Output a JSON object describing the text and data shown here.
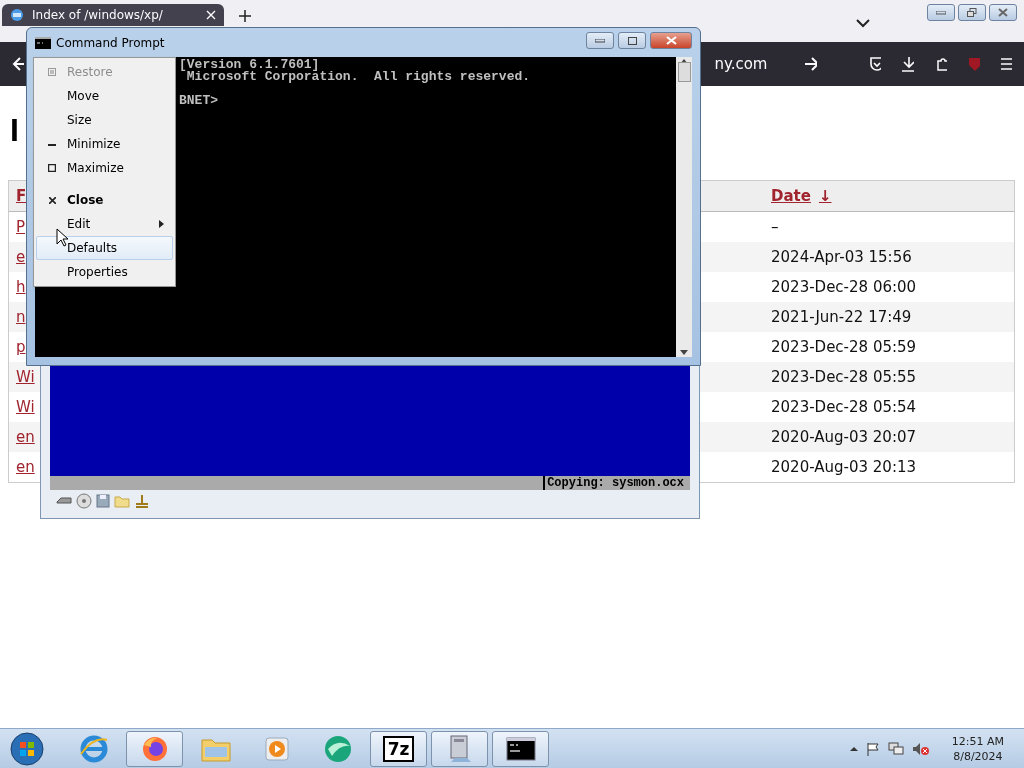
{
  "browser": {
    "tab": {
      "title": "Index of /windows/xp/"
    },
    "address_fragment": "ny.com",
    "page": {
      "heading": "I",
      "table": {
        "columns": [
          {
            "label": "F"
          },
          {
            "label": "Date",
            "sort_mark": "↓"
          }
        ],
        "rows": [
          {
            "name": "P",
            "date": "–"
          },
          {
            "name": "e",
            "date": "2024-Apr-03 15:56"
          },
          {
            "name": "h",
            "date": "2023-Dec-28 06:00"
          },
          {
            "name": "n",
            "date": "2021-Jun-22 17:49"
          },
          {
            "name": "p",
            "date": "2023-Dec-28 05:59"
          },
          {
            "name": "Wi",
            "date": "2023-Dec-28 05:55"
          },
          {
            "name": "Wi",
            "date": "2023-Dec-28 05:54"
          },
          {
            "name": "en",
            "date": "2020-Aug-03 20:07"
          },
          {
            "name": "en",
            "date": "2020-Aug-03 20:13"
          }
        ]
      }
    }
  },
  "cmd_window": {
    "title": "Command Prompt",
    "lines": [
      "[Version 6.1.7601]",
      " Microsoft Corporation.  All rights reserved."
    ],
    "prompt": "BNET>",
    "system_menu": {
      "items": [
        {
          "kind": "restore",
          "label": "Restore",
          "disabled": true,
          "default": false,
          "submenu": false,
          "selected": false
        },
        {
          "kind": "plain",
          "label": "Move",
          "disabled": false,
          "default": false,
          "submenu": false,
          "selected": false
        },
        {
          "kind": "plain",
          "label": "Size",
          "disabled": false,
          "default": false,
          "submenu": false,
          "selected": false
        },
        {
          "kind": "minimize",
          "label": "Minimize",
          "disabled": false,
          "default": false,
          "submenu": false,
          "selected": false
        },
        {
          "kind": "maximize",
          "label": "Maximize",
          "disabled": false,
          "default": false,
          "submenu": false,
          "selected": false
        },
        {
          "kind": "separator"
        },
        {
          "kind": "close",
          "label": "Close",
          "disabled": false,
          "default": true,
          "submenu": false,
          "selected": false
        },
        {
          "kind": "plain",
          "label": "Edit",
          "disabled": false,
          "default": false,
          "submenu": true,
          "selected": false
        },
        {
          "kind": "plain",
          "label": "Defaults",
          "disabled": false,
          "default": false,
          "submenu": false,
          "selected": true
        },
        {
          "kind": "plain",
          "label": "Properties",
          "disabled": false,
          "default": false,
          "submenu": false,
          "selected": false
        }
      ]
    }
  },
  "setup_window": {
    "status": "Copying: sysmon.ocx"
  },
  "taskbar": {
    "apps": [
      {
        "kind": "ie",
        "open": false
      },
      {
        "kind": "firefox",
        "open": true
      },
      {
        "kind": "explorer",
        "open": false
      },
      {
        "kind": "media",
        "open": false
      },
      {
        "kind": "green",
        "open": false
      },
      {
        "kind": "sevenzip",
        "label": "7z",
        "open": true
      },
      {
        "kind": "computer",
        "open": true
      },
      {
        "kind": "console",
        "open": true
      }
    ],
    "clock": {
      "time": "12:51 AM",
      "date": "8/8/2024"
    }
  }
}
